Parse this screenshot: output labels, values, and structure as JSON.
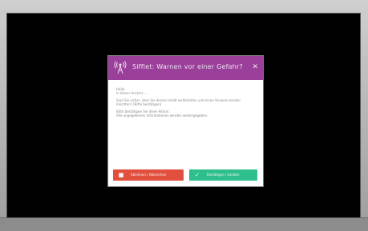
{
  "dialog": {
    "title": "Sifflet: Warnen vor einer Gefahr?",
    "body": [
      "Hallo,",
      "in dieser Ansicht ...",
      "Sind Sie sicher, dass Sie diesen Inhalt weiterleiten und einen Hinweis senden",
      "möchten? (Bitte bestätigen)",
      "Bitte bestätigen Sie diese Aktion.",
      "Alle angegebenen Informationen werden weitergegeben."
    ],
    "reject_label": "Ablehnen / Abbrechen",
    "accept_label": "Bestätigen / Senden"
  },
  "colors": {
    "header": "#9a3f9a",
    "reject": "#e34f3d",
    "accept": "#2fbf8d",
    "screen": "#010101",
    "frame": "#b4b4b4"
  },
  "icons": {
    "header": "signal-tower-icon",
    "close": "close-icon",
    "reject": "stop-icon",
    "accept": "check-icon"
  }
}
